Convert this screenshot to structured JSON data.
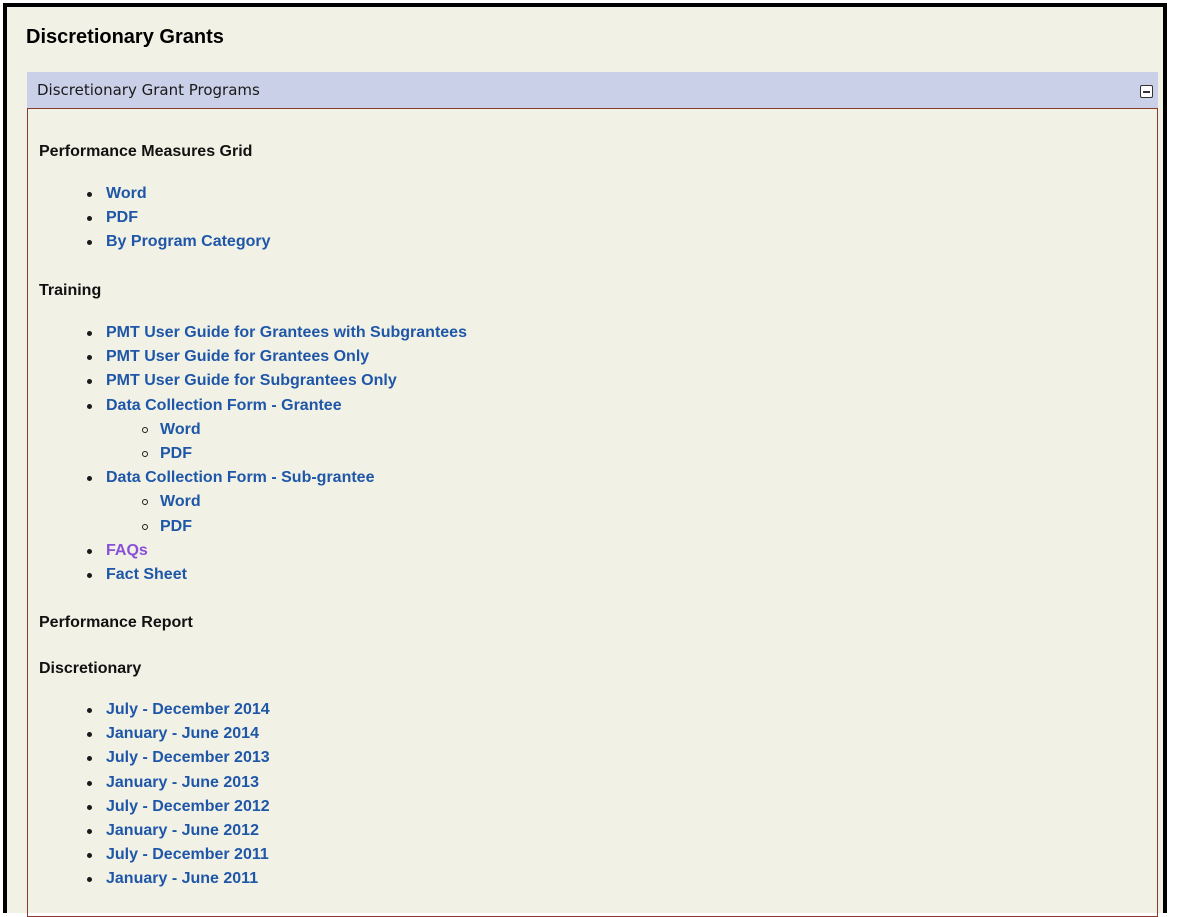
{
  "page": {
    "title": "Discretionary Grants"
  },
  "panel": {
    "title": "Discretionary Grant Programs",
    "collapse_icon": "minus-box-icon"
  },
  "sections": {
    "performance_measures": {
      "heading": "Performance Measures Grid",
      "links": [
        "Word",
        "PDF",
        "By Program Category"
      ]
    },
    "training": {
      "heading": "Training",
      "guide_grantees_with_subgrantees": "PMT User Guide for Grantees with Subgrantees",
      "guide_grantees_only": "PMT User Guide for Grantees Only",
      "guide_subgrantees_only": "PMT User Guide for Subgrantees Only",
      "dcf_grantee": {
        "label": "Data Collection Form - Grantee",
        "word": "Word",
        "pdf": "PDF"
      },
      "dcf_subgrantee": {
        "label": "Data Collection Form - Sub-grantee",
        "word": "Word",
        "pdf": "PDF"
      },
      "faqs": "FAQs",
      "fact_sheet": "Fact Sheet"
    },
    "performance_report": {
      "heading": "Performance Report"
    },
    "discretionary": {
      "heading": "Discretionary",
      "links": [
        "July - December 2014",
        "January - June 2014",
        "July - December 2013",
        "January - June 2013",
        "July - December 2012",
        "January - June 2012",
        "July - December 2011",
        "January - June 2011"
      ]
    }
  },
  "colors": {
    "page_background": "#f2f1e6",
    "panel_header": "#c9d0e8",
    "link": "#1f57a8",
    "visited_link": "#8a4fd8",
    "panel_border": "#8a3b2e"
  }
}
